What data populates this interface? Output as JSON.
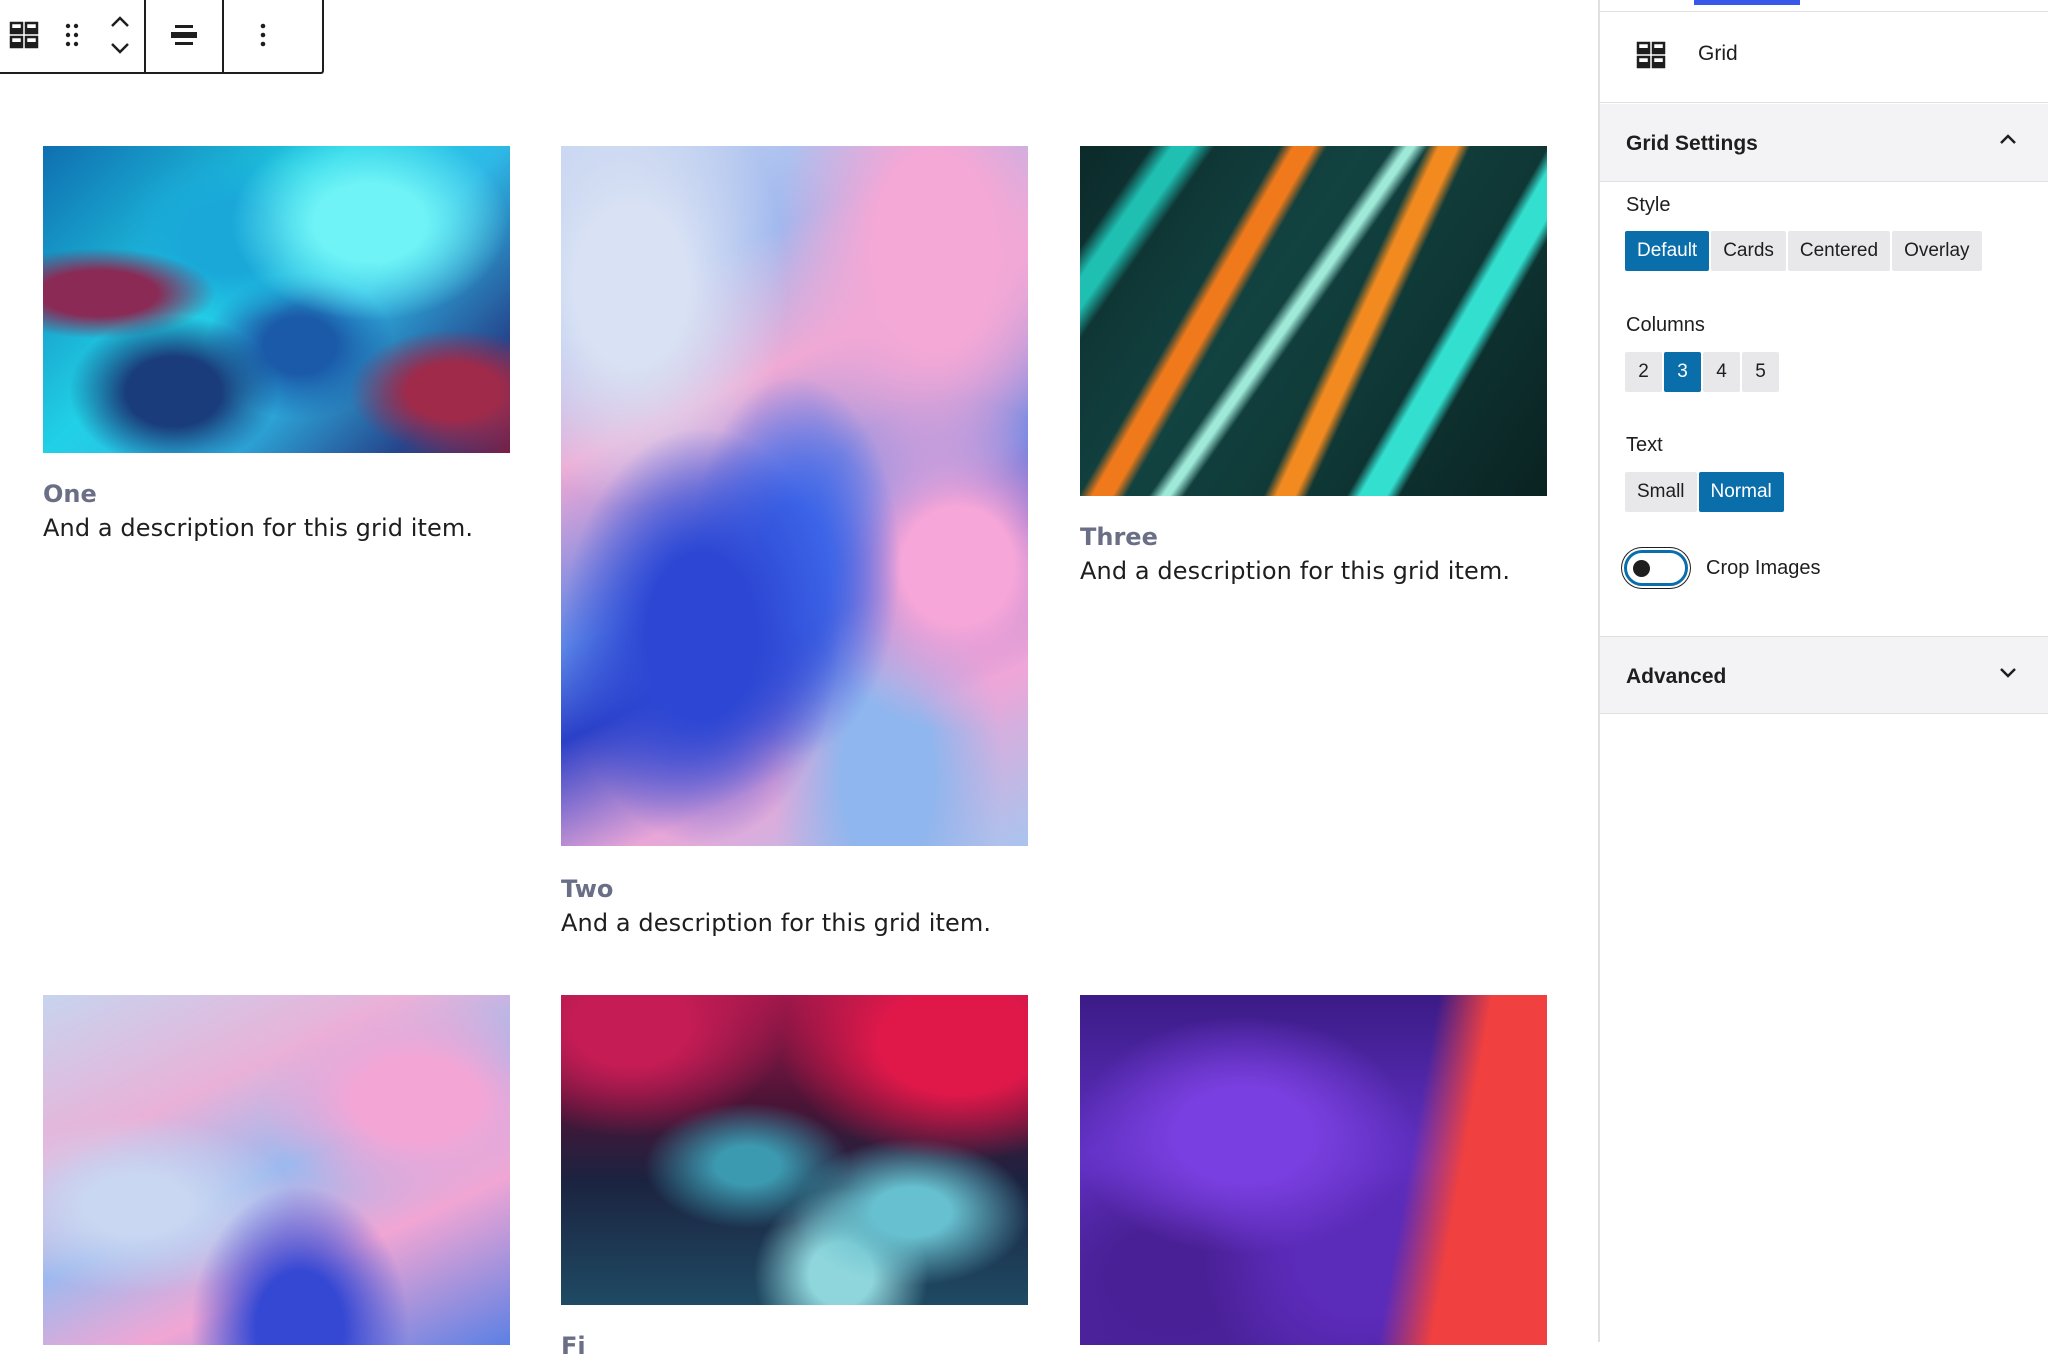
{
  "toolbar": {
    "block_icon": "grid-icon",
    "drag_icon": "drag-handle-icon",
    "move_icon": "chevron-up-down-icon",
    "align_icon": "align-icon",
    "more_icon": "more-vertical-icon"
  },
  "grid_items": [
    {
      "title": "One",
      "description": "And a description for this grid item."
    },
    {
      "title": "Two",
      "description": "And a description for this grid item."
    },
    {
      "title": "Three",
      "description": "And a description for this grid item."
    },
    {
      "title": "",
      "description": ""
    },
    {
      "title": "Fi",
      "description": ""
    },
    {
      "title": "",
      "description": ""
    }
  ],
  "sidebar": {
    "block_name": "Grid",
    "block_icon": "grid-icon",
    "grid_settings": {
      "title": "Grid Settings",
      "style_label": "Style",
      "style_options": [
        "Default",
        "Cards",
        "Centered",
        "Overlay"
      ],
      "style_selected": "Default",
      "columns_label": "Columns",
      "column_options": [
        "2",
        "3",
        "4",
        "5"
      ],
      "columns_selected": "3",
      "text_label": "Text",
      "text_options": [
        "Small",
        "Normal"
      ],
      "text_selected": "Normal",
      "crop_images_label": "Crop Images",
      "crop_images_on": false
    },
    "advanced": {
      "title": "Advanced"
    }
  },
  "colors": {
    "accent": "#0a6eab",
    "tab_indicator": "#3858e9",
    "title_muted": "#6b6f86"
  }
}
